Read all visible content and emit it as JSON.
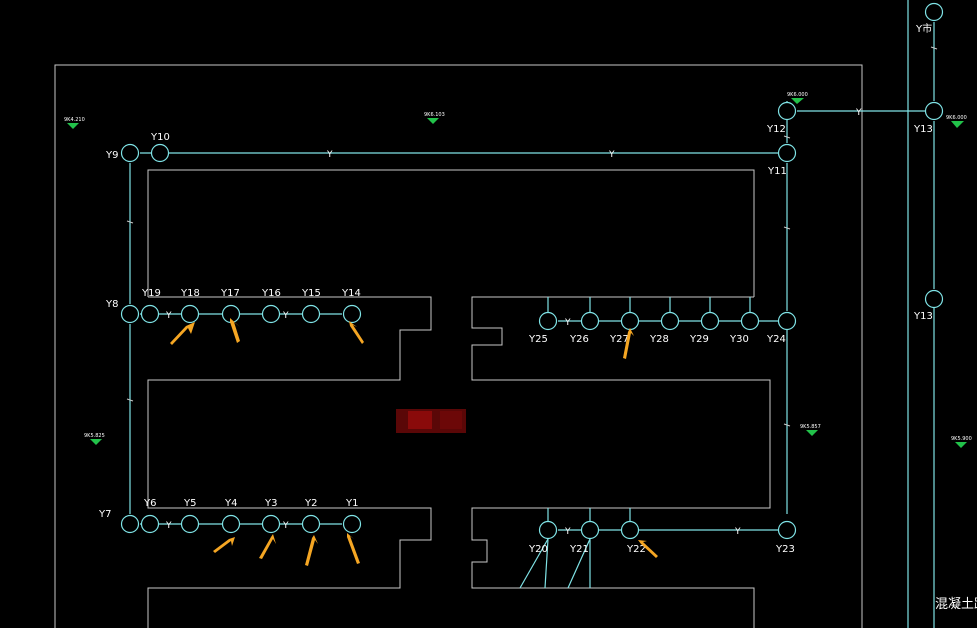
{
  "colors": {
    "background": "#000000",
    "pipe": "#7fe3e6",
    "outline": "#c8c8c8",
    "arrow": "#f5a623",
    "elevation_marker": "#22c24a",
    "redacted": "#8a0a0a"
  },
  "manholes": {
    "Y1": "Y1",
    "Y2": "Y2",
    "Y3": "Y3",
    "Y4": "Y4",
    "Y5": "Y5",
    "Y6": "Y6",
    "Y7": "Y7",
    "Y8": "Y8",
    "Y9": "Y9",
    "Y10": "Y10",
    "Y11": "Y11",
    "Y12": "Y12",
    "Y13a": "Y13",
    "Y13b": "Y13",
    "Y14": "Y14",
    "Y15": "Y15",
    "Y16": "Y16",
    "Y17": "Y17",
    "Y18": "Y18",
    "Y19": "Y19",
    "Y20": "Y20",
    "Y21": "Y21",
    "Y22": "Y22",
    "Y23": "Y23",
    "Y24": "Y24",
    "Y25": "Y25",
    "Y26": "Y26",
    "Y27": "Y27",
    "Y28": "Y28",
    "Y29": "Y29",
    "Y30": "Y30",
    "Ymun": "Y市"
  },
  "pipe_label": "Y",
  "elevations": {
    "e1": "9K4.210",
    "e2": "9K6.103",
    "e3": "9K6.000",
    "e4": "9K6.000",
    "e5": "9K5.825",
    "e6": "9K5.857",
    "e7": "9K5.900"
  },
  "road_label": "混凝土路"
}
